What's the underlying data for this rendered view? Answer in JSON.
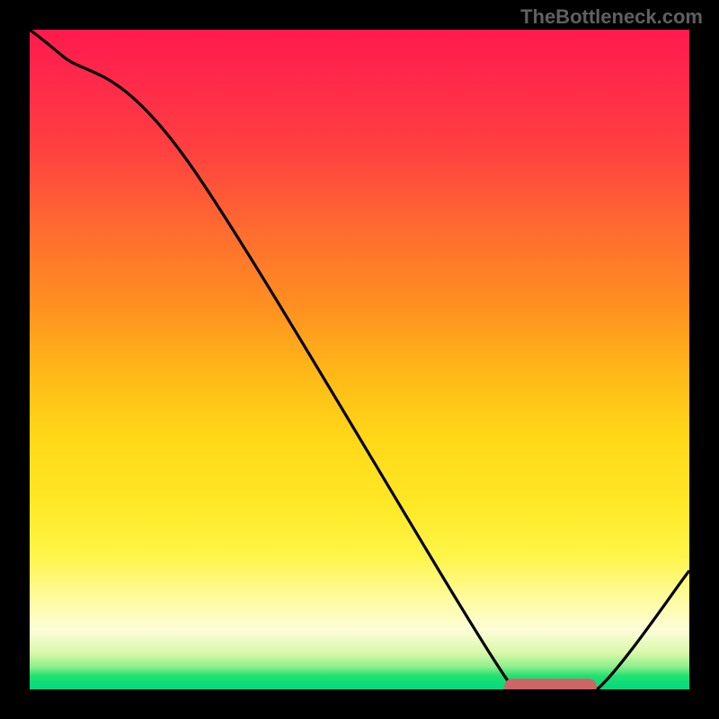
{
  "watermark": "TheBottleneck.com",
  "chart_data": {
    "type": "line",
    "title": "",
    "xlabel": "",
    "ylabel": "",
    "xlim": [
      0,
      100
    ],
    "ylim": [
      0,
      100
    ],
    "x": [
      0,
      5,
      24,
      72,
      78,
      86,
      100
    ],
    "values": [
      100,
      96,
      80,
      2,
      0,
      0,
      18
    ],
    "marker": {
      "x_start": 72,
      "x_end": 86,
      "y": 0
    },
    "background_gradient": {
      "stops": [
        {
          "pos": 0.0,
          "color": "#ff1a4d"
        },
        {
          "pos": 0.5,
          "color": "#ffc818"
        },
        {
          "pos": 0.85,
          "color": "#fffb9a"
        },
        {
          "pos": 1.0,
          "color": "#00d880"
        }
      ]
    }
  }
}
